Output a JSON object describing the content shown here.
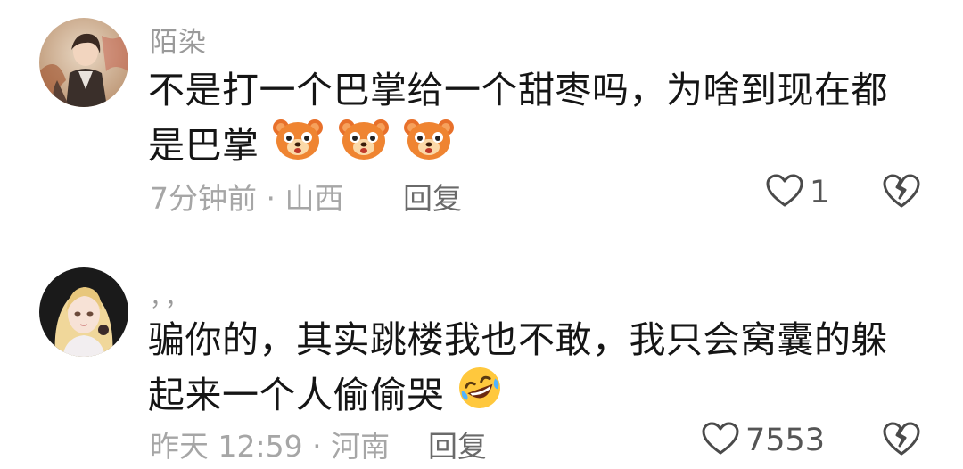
{
  "comments": [
    {
      "username": "陌染",
      "content": "不是打一个巴掌给一个甜枣吗，为啥到现在都是巴掌",
      "emojis": [
        "bear-face-emoji",
        "bear-face-emoji",
        "bear-face-emoji"
      ],
      "time": "7分钟前",
      "location": "山西",
      "separator": "·",
      "reply_label": "回复",
      "like_count": "1"
    },
    {
      "username": "，，",
      "content": "骗你的，其实跳楼我也不敢，我只会窝囊的躲起来一个人偷偷哭",
      "emojis": [
        "rolling-laughing-emoji"
      ],
      "time": "昨天 12:59",
      "location": "河南",
      "separator": "·",
      "reply_label": "回复",
      "like_count": "7553"
    }
  ],
  "colors": {
    "meta": "#a6a6a6",
    "reply": "#6a6a6a",
    "text": "#151515"
  }
}
